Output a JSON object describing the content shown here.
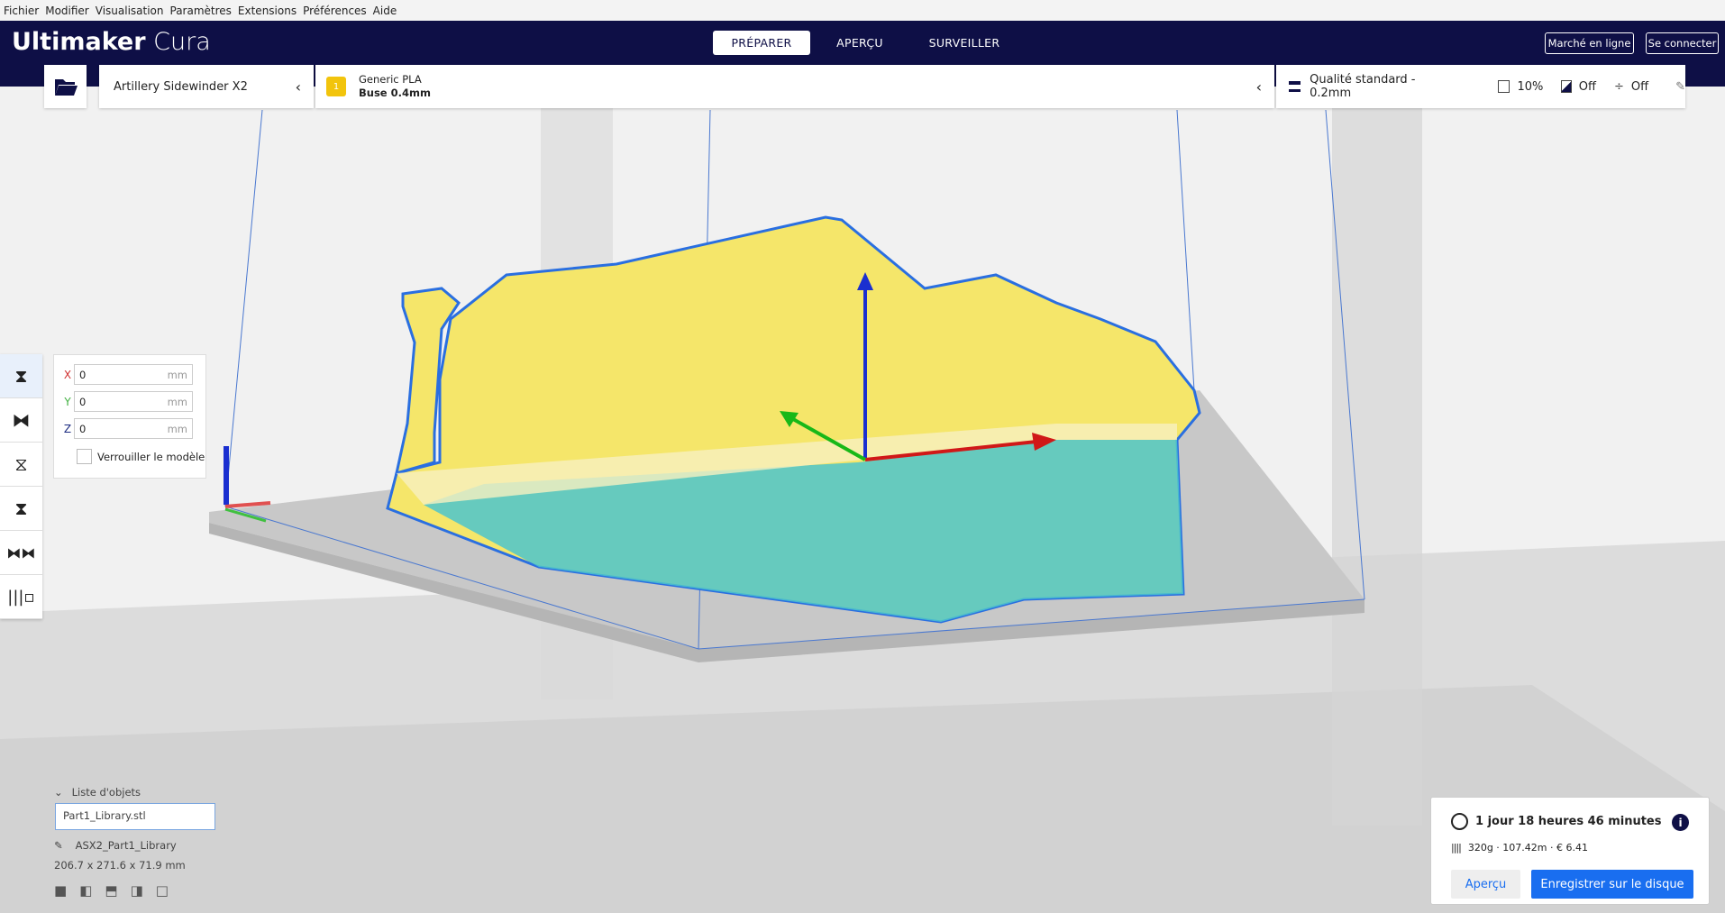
{
  "menu": [
    "Fichier",
    "Modifier",
    "Visualisation",
    "Paramètres",
    "Extensions",
    "Préférences",
    "Aide"
  ],
  "header": {
    "brand_bold": "Ultimaker",
    "brand_light": "Cura",
    "tabs": [
      "PRÉPARER",
      "APERÇU",
      "SURVEILLER"
    ],
    "active_tab": "PRÉPARER",
    "marketplace": "Marché en ligne",
    "signin": "Se connecter"
  },
  "printer": {
    "name": "Artillery Sidewinder X2"
  },
  "material": {
    "extruder": "1",
    "name": "Generic PLA",
    "nozzle": "Buse 0.4mm"
  },
  "quality": {
    "profile": "Qualité standard - 0.2mm",
    "infill": "10%",
    "support": "Off",
    "adhesion": "Off"
  },
  "move_tool": {
    "x_label": "X",
    "x": "0",
    "y_label": "Y",
    "y": "0",
    "z_label": "Z",
    "z": "0",
    "unit": "mm",
    "lock_label": "Verrouiller le modèle"
  },
  "objects": {
    "title": "Liste d'objets",
    "file": "Part1_Library.stl",
    "job_name": "ASX2_Part1_Library",
    "dimensions": "206.7 x 271.6 x 71.9 mm"
  },
  "estimate": {
    "time": "1 jour 18 heures 46 minutes",
    "material": "320g · 107.42m · € 6.41",
    "preview_button": "Aperçu",
    "save_button": "Enregistrer sur le disque"
  },
  "colors": {
    "header": "#0e0f46",
    "accent": "#196ef0",
    "model": "#f5e66a",
    "outline": "#2a6fe0"
  }
}
